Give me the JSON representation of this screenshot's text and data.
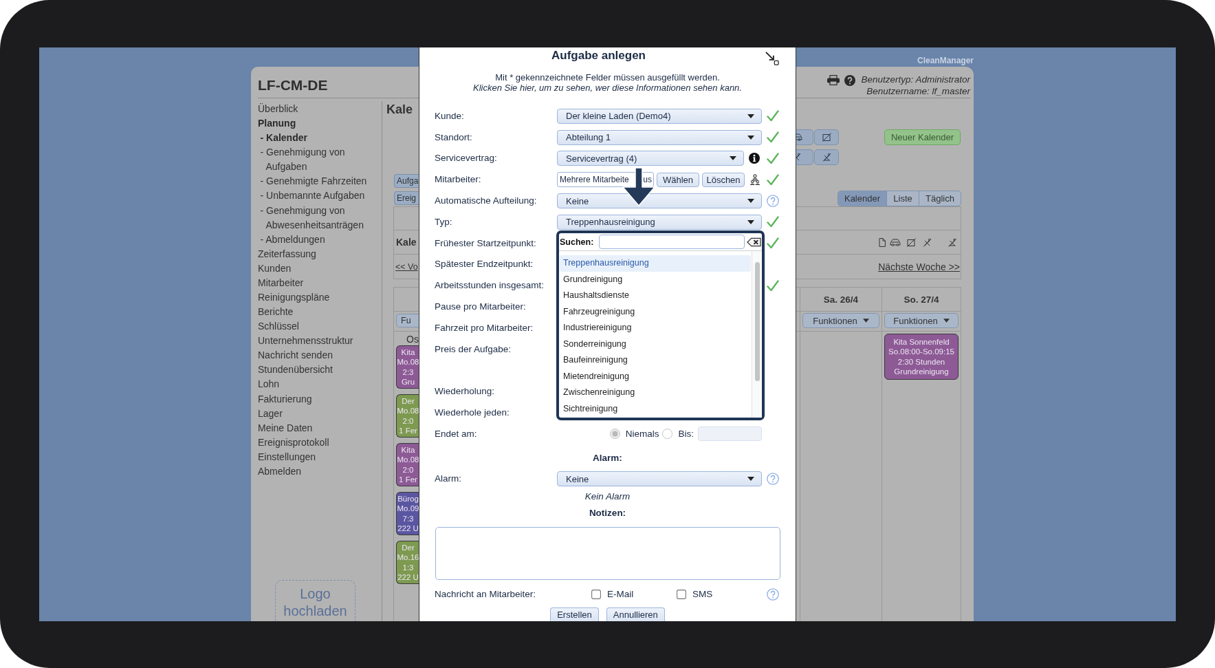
{
  "brand": "CleanManager",
  "header": {
    "title": "LF-CM-DE",
    "user_type": "Benutzertyp: Administrator",
    "user_name": "Benutzername: lf_master"
  },
  "sidebar": {
    "items": [
      {
        "label": "Überblick",
        "selected": false
      },
      {
        "label": "Planung",
        "selected": true,
        "children": [
          {
            "label": "- Kalender",
            "selected": true
          },
          {
            "label": "- Genehmigung von Aufgaben",
            "selected": false
          },
          {
            "label": "- Genehmigte Fahrzeiten",
            "selected": false
          },
          {
            "label": "- Unbemannte Aufgaben",
            "selected": false
          },
          {
            "label": "- Genehmigung von Abwesenheitsanträgen",
            "selected": false
          },
          {
            "label": "- Abmeldungen",
            "selected": false
          }
        ]
      },
      {
        "label": "Zeiterfassung",
        "selected": false
      },
      {
        "label": "Kunden",
        "selected": false
      },
      {
        "label": "Mitarbeiter",
        "selected": false
      },
      {
        "label": "Reinigungspläne",
        "selected": false
      },
      {
        "label": "Berichte",
        "selected": false
      },
      {
        "label": "Schlüssel",
        "selected": false
      },
      {
        "label": "Unternehmensstruktur",
        "selected": false
      },
      {
        "label": "Nachricht senden",
        "selected": false
      },
      {
        "label": "Stundenübersicht",
        "selected": false
      },
      {
        "label": "Lohn",
        "selected": false
      },
      {
        "label": "Fakturierung",
        "selected": false
      },
      {
        "label": "Lager",
        "selected": false
      },
      {
        "label": "Meine Daten",
        "selected": false
      },
      {
        "label": "Ereignisprotokoll",
        "selected": false
      },
      {
        "label": "Einstellungen",
        "selected": false
      },
      {
        "label": "Abmelden",
        "selected": false
      }
    ],
    "logo_upload": "Logo hochladen"
  },
  "calendar": {
    "title": "Kale",
    "side_buttons": [
      "Aufga",
      "Ereig"
    ],
    "new_calendar_button": "Neuer Kalender",
    "view_tabs": [
      {
        "label": "Kalender",
        "selected": true
      },
      {
        "label": "Liste",
        "selected": false
      },
      {
        "label": "Täglich",
        "selected": false
      }
    ],
    "toolbar_title": "Kale",
    "prev_link": "<< Vo",
    "next_link": "Nächste Woche >>",
    "left_day": {
      "button": "Fu",
      "note": "Os",
      "events": [
        {
          "color": "#8d5a96",
          "lines": [
            "Kita",
            "Mo.08",
            "2:3",
            "Gru"
          ]
        },
        {
          "color": "#7d9a50",
          "lines": [
            "Der",
            "Mo.08",
            "2:0",
            "1 Fer"
          ]
        },
        {
          "color": "#8d5a96",
          "lines": [
            "Kita",
            "Mo.08",
            "2:0",
            "1 Fer"
          ]
        },
        {
          "color": "#5b56a1",
          "lines": [
            "Bürog",
            "Mo.09",
            "7:3",
            "222 U"
          ]
        },
        {
          "color": "#7d9a50",
          "lines": [
            "Der",
            "Mo.16",
            "1:3",
            "222 U"
          ]
        }
      ]
    },
    "days": [
      {
        "label": "Sa. 26/4",
        "button": "Funktionen"
      },
      {
        "label": "So. 27/4",
        "button": "Funktionen",
        "events": [
          {
            "color": "#8d5a96",
            "lines": [
              "Kita Sonnenfeld",
              "So.08:00-So.09:15",
              "2:30 Stunden",
              "Grundreinigung"
            ]
          }
        ]
      }
    ]
  },
  "dialog": {
    "title": "Aufgabe anlegen",
    "required_note": "Mit * gekennzeichnete Felder müssen ausgefüllt werden.",
    "visibility_link": "Klicken Sie hier, um zu sehen, wer diese Informationen sehen kann.",
    "fields": [
      {
        "label": "Kunde:",
        "kind": "select",
        "value": "Der kleine Laden (Demo4)",
        "valid": true
      },
      {
        "label": "Standort:",
        "kind": "select",
        "value": "Abteilung 1",
        "valid": true
      },
      {
        "label": "Servicevertrag:",
        "kind": "select_info",
        "value": "Servicevertrag (4)",
        "valid": true
      },
      {
        "label": "Mitarbeiter:",
        "kind": "employees",
        "value_parts": [
          "Mehrere Mitarbeite",
          "us"
        ],
        "buttons": [
          "Wählen",
          "Löschen"
        ],
        "valid": true
      },
      {
        "label": "Automatische Aufteilung:",
        "kind": "select",
        "value": "Keine",
        "valid": false,
        "help": true
      },
      {
        "label": "Typ:",
        "kind": "select",
        "value": "Treppenhausreinigung",
        "valid": true
      },
      {
        "label": "Frühester Startzeitpunkt:",
        "kind": "plain",
        "valid": true
      },
      {
        "label": "Spätester Endzeitpunkt:",
        "kind": "plain",
        "valid": false
      },
      {
        "label": "Arbeitsstunden insgesamt:",
        "kind": "plain",
        "valid": true
      },
      {
        "label": "Pause pro Mitarbeiter:",
        "kind": "plain",
        "valid": false
      },
      {
        "label": "Fahrzeit pro Mitarbeiter:",
        "kind": "plain",
        "valid": false
      },
      {
        "label": "Preis der Aufgabe:",
        "kind": "price",
        "valid": false
      },
      {
        "label": "Wiederholung:",
        "kind": "plain",
        "valid": false
      },
      {
        "label": "Wiederhole jeden:",
        "kind": "plain",
        "valid": false
      },
      {
        "label": "Endet am:",
        "kind": "end",
        "options": [
          {
            "label": "Niemals",
            "selected": true
          },
          {
            "label": "Bis:",
            "selected": false
          }
        ],
        "date_disabled": true,
        "valid": false
      }
    ],
    "alarm_heading": "Alarm:",
    "alarm": {
      "label": "Alarm:",
      "value": "Keine",
      "help": true
    },
    "alarm_status": "Kein Alarm",
    "notes_heading": "Notizen:",
    "message": {
      "label": "Nachricht an Mitarbeiter:",
      "channels": [
        {
          "label": "E-Mail",
          "checked": false
        },
        {
          "label": "SMS",
          "checked": false
        }
      ],
      "help": true
    },
    "buttons": [
      "Erstellen",
      "Annullieren"
    ],
    "type_dropdown": {
      "search_label": "Suchen:",
      "options": [
        {
          "label": "Treppenhausreinigung",
          "selected": true
        },
        {
          "label": "Grundreinigung",
          "selected": false
        },
        {
          "label": "Haushaltsdienste",
          "selected": false
        },
        {
          "label": "Fahrzeugreinigung",
          "selected": false
        },
        {
          "label": "Industriereinigung",
          "selected": false
        },
        {
          "label": "Sonderreinigung",
          "selected": false
        },
        {
          "label": "Baufeinreinigung",
          "selected": false
        },
        {
          "label": "Mietendreinigung",
          "selected": false
        },
        {
          "label": "Zwischenreinigung",
          "selected": false
        },
        {
          "label": "Sichtreinigung",
          "selected": false
        }
      ]
    }
  }
}
